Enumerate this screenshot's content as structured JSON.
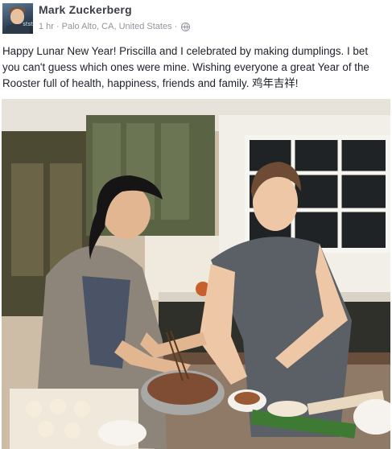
{
  "post": {
    "author": "Mark Zuckerberg",
    "time": "1 hr",
    "location": "Palo Alto, CA, United States",
    "separator": "·",
    "avatar_tag": "stst",
    "message": "Happy Lunar New Year! Priscilla and I celebrated by making dumplings. I bet you can't guess which ones were mine. Wishing everyone a great Year of the Rooster full of health, happiness, friends and family. 鸡年吉祥!"
  },
  "icons": {
    "privacy": "globe-icon"
  }
}
